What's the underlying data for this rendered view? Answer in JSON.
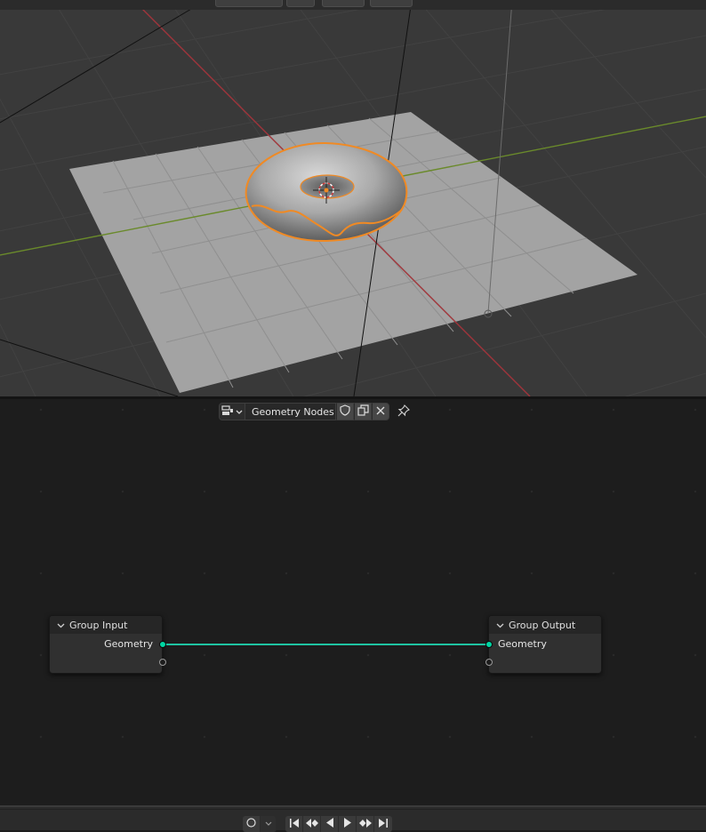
{
  "viewport": {
    "header_tools": [
      "view-tool",
      "select-tool",
      "snap-tool",
      "shading-tool",
      "overlay-tool"
    ]
  },
  "node_editor": {
    "header": {
      "editor_type_icon": "geometry-node-tree-icon",
      "nodegroup_name": "Geometry Nodes",
      "fake_user_icon": "shield-icon",
      "duplicate_icon": "duplicate-icon",
      "unlink_icon": "close-icon",
      "pin_icon": "pin-icon"
    },
    "nodes": {
      "group_input": {
        "title": "Group Input",
        "socket_label": "Geometry"
      },
      "group_output": {
        "title": "Group Output",
        "socket_label": "Geometry"
      }
    },
    "colors": {
      "geometry_socket": "#00d6a3",
      "link": "#1fc4a2",
      "selection_outline": "#f08a24"
    }
  },
  "timeline": {
    "icons": [
      "keyframe-icon",
      "dropdown-icon",
      "jump-start-icon",
      "prev-keyframe-icon",
      "play-reverse-icon",
      "play-icon",
      "next-keyframe-icon",
      "jump-end-icon"
    ]
  }
}
